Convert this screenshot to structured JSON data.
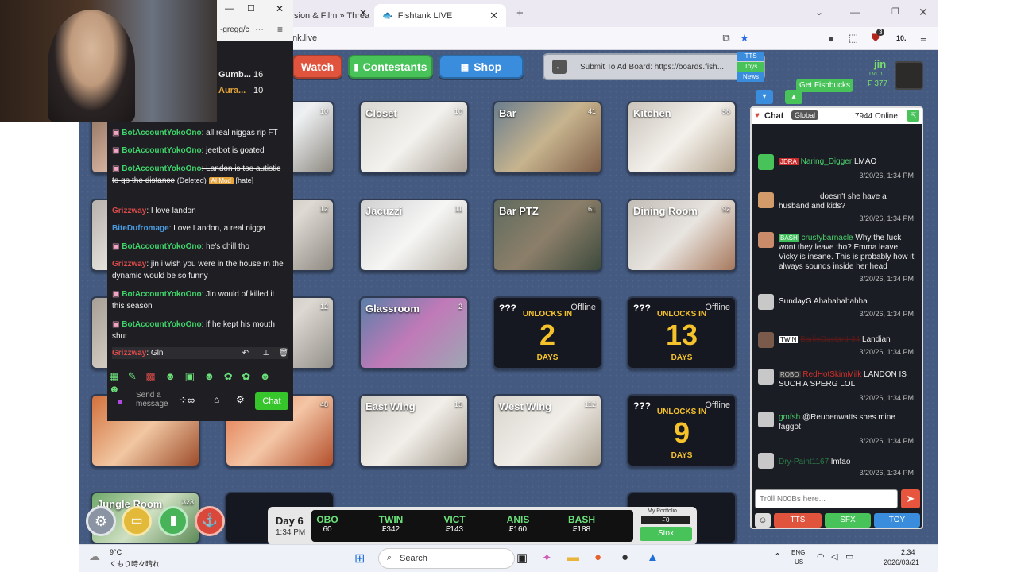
{
  "browser": {
    "tabs": [
      {
        "label": "sion & Film » Threa"
      },
      {
        "label": "Fishtank LIVE"
      }
    ],
    "address_fragment": "nk.live",
    "popup_address": "-gregg/c",
    "ext_badge": "3",
    "ext_text": "10."
  },
  "nav": {
    "watch": "Watch",
    "contestants": "Contestants",
    "shop": "Shop",
    "ad_board": "Submit To Ad Board: https://boards.fish...",
    "tts": "TTS",
    "toys": "Toys",
    "news": "News"
  },
  "user": {
    "name": "jin",
    "level": "LVL 1",
    "balance": "₣ 377",
    "fishbucks_btn": "Get Fishbucks"
  },
  "cams": [
    {
      "label": "",
      "count": "10"
    },
    {
      "label": "Closet",
      "count": "10"
    },
    {
      "label": "Bar",
      "count": "41"
    },
    {
      "label": "Kitchen",
      "count": "56"
    },
    {
      "label": "",
      "count": "12"
    },
    {
      "label": "Jacuzzi",
      "count": "11"
    },
    {
      "label": "Bar PTZ",
      "count": "61"
    },
    {
      "label": "Dining Room",
      "count": "92"
    },
    {
      "label": "",
      "count": "12"
    },
    {
      "label": "Glassroom",
      "count": "2"
    },
    {
      "label": "",
      "count": "48"
    },
    {
      "label": "East Wing",
      "count": "15"
    },
    {
      "label": "West Wing",
      "count": "112"
    },
    {
      "label": "Jungle Room",
      "count": "323"
    }
  ],
  "locked": [
    {
      "q": "???",
      "off": "Offline",
      "unlocks": "UNLOCKS IN",
      "num": "2",
      "days": "DAYS"
    },
    {
      "q": "???",
      "off": "Offline",
      "unlocks": "UNLOCKS IN",
      "num": "13",
      "days": "DAYS"
    },
    {
      "q": "???",
      "off": "Offline",
      "unlocks": "UNLOCKS IN",
      "num": "9",
      "days": "DAYS"
    }
  ],
  "chat": {
    "title": "Chat",
    "global": "Global",
    "online": "7944 Online",
    "messages": [
      {
        "badge": "JDRA",
        "user": "Naring_Digger",
        "text": "LMAO",
        "ts": "3/20/26, 1:34 PM"
      },
      {
        "badge": "",
        "user": "",
        "text": "doesn't she have a husband and kids?",
        "ts": "3/20/26, 1:34 PM"
      },
      {
        "badge": "BASH",
        "user": "crustybarnacle",
        "text": "Why the fuck wont they leave tho? Emma leave. Vicky is insane. This is probably how it always sounds inside her head",
        "ts": "3/20/26, 1:34 PM"
      },
      {
        "badge": "",
        "user": "SundayG",
        "text": "Ahahahahahha",
        "ts": "3/20/26, 1:34 PM"
      },
      {
        "badge": "TWIN",
        "user": "",
        "text": "Landian",
        "ts": "3/20/26, 1:34 PM"
      },
      {
        "badge": "ROBO",
        "user": "RedHotSkimMilk",
        "text": "LANDON IS SUCH A SPERG LOL",
        "ts": "3/20/26, 1:34 PM"
      },
      {
        "badge": "",
        "user": "gmfsh",
        "text": "@Reubenwatts shes mine faggot",
        "ts": "3/20/26, 1:34 PM"
      },
      {
        "badge": "",
        "user": "Dry-Paint1167",
        "text": "lmfao",
        "ts": "3/20/26, 1:34 PM"
      }
    ],
    "input_placeholder": "Tr0ll N00Bs here...",
    "tts": "TTS",
    "sfx": "SFX",
    "toy": "TOY"
  },
  "overlay_chat": {
    "header_rows": [
      {
        "name": "Gumb...",
        "num": "16"
      },
      {
        "name": "Aura...",
        "num": "10"
      }
    ],
    "messages": [
      {
        "user": "BotAccountYokoOno",
        "text": ": all real niggas rip FT",
        "color": "#3fd46b"
      },
      {
        "user": "BotAccountYokoOno",
        "text": ": jeetbot is goated",
        "color": "#3fd46b"
      },
      {
        "user": "BotAccountYokoOno",
        "text": ": Landon is too autistic to go the distance",
        "color": "#3fd46b",
        "deleted": "(Deleted)",
        "mod": "AI Mod",
        "tag": "[hate]"
      },
      {
        "user": "Grizzway",
        "text": ": I love landon",
        "color": "#d94a4a"
      },
      {
        "user": "BiteDufromage",
        "text": ": Love Landon, a real nigga",
        "color": "#4a9ae0"
      },
      {
        "user": "BotAccountYokoOno",
        "text": ": he's chill tho",
        "color": "#3fd46b"
      },
      {
        "user": "Grizzway",
        "text": ": jin i wish you were in the house rn the dynamic would be so funny",
        "color": "#d94a4a"
      },
      {
        "user": "BotAccountYokoOno",
        "text": ": Jin would of killed it this season",
        "color": "#3fd46b"
      },
      {
        "user": "BotAccountYokoOno",
        "text": ": if he kept his mouth shut",
        "color": "#3fd46b"
      },
      {
        "user": "Grizzway",
        "text": ": Gln",
        "color": "#d94a4a"
      }
    ],
    "send_placeholder": "Send a message",
    "chat_btn": "Chat"
  },
  "ticker": {
    "day": "Day 6",
    "time": "1:34 PM",
    "items": [
      {
        "name": "OBO",
        "val": "60"
      },
      {
        "name": "TWIN",
        "val": "₣342"
      },
      {
        "name": "VICT",
        "val": "₣143"
      },
      {
        "name": "ANIS",
        "val": "₣160"
      },
      {
        "name": "BASH",
        "val": "₣188"
      }
    ],
    "portfolio": "My Portfolio",
    "portfolio_val": "₣0",
    "stox": "Stox"
  },
  "taskbar": {
    "weather_temp": "9°C",
    "weather_desc": "くもり時々晴れ",
    "search": "Search",
    "lang1": "ENG",
    "lang2": "US",
    "time": "2:34",
    "date": "2026/03/21"
  }
}
